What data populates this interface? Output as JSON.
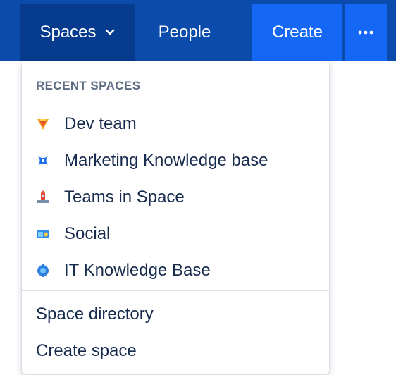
{
  "nav": {
    "spaces_label": "Spaces",
    "people_label": "People",
    "create_label": "Create",
    "more_icon": "more-icon",
    "colors": {
      "bar": "#0a4bab",
      "active": "#073b8d",
      "create": "#1468f5"
    }
  },
  "dropdown": {
    "heading": "RECENT SPACES",
    "spaces": [
      {
        "label": "Dev team",
        "icon": "dev-team-icon"
      },
      {
        "label": "Marketing Knowledge base",
        "icon": "marketing-icon"
      },
      {
        "label": "Teams in Space",
        "icon": "teams-in-space-icon"
      },
      {
        "label": "Social",
        "icon": "social-icon"
      },
      {
        "label": "IT Knowledge Base",
        "icon": "it-knowledge-base-icon"
      }
    ],
    "footer": [
      {
        "label": "Space directory"
      },
      {
        "label": "Create space"
      }
    ]
  }
}
